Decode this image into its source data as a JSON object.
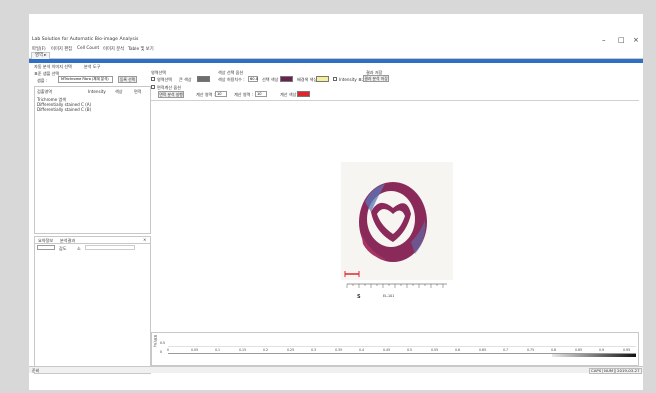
{
  "window": {
    "title": "Lab Solution for Automatic Bio-image Analysis",
    "minimize": "–",
    "maximize": "□",
    "close": "×"
  },
  "menu": [
    "파일(F)",
    "이미지 편집",
    "Cell Count",
    "이미지 분석",
    "Table 및 보기"
  ],
  "doc_tab": "영역 ▸",
  "toolbar_row": {
    "left_label": "자동 분석 이미지 선택",
    "right_label": "분석 도구"
  },
  "left_panel": {
    "sample_label": "표준 샘플 선택",
    "select_label": "샘플 :",
    "select_value": "MTrichrome Fibro (체계 분석)",
    "add_button": "등록 선택",
    "table_headers": [
      "검출영역",
      "Intensity",
      "색상",
      "면적"
    ],
    "table_rows": [
      "Trichrome 염색",
      "Differentially stained C (A)",
      "Differentially stained C (B)"
    ],
    "bottom_tabs": [
      "요약정보",
      "분석결과"
    ],
    "bottom_fields": [
      "감도",
      "소"
    ]
  },
  "right_panel": {
    "region_label": "영역선택",
    "region_check": "영역선택",
    "bg_color_label": "큰 색상",
    "color_select_label": "색상 선택 옵션",
    "tolerance_label": "색상 허용치수 :",
    "tolerance_value": "60.0",
    "select_color_label": "선택 색상 :",
    "bg_color2_label": "배경색 색상 :",
    "intensity_label": "Intensity 표기",
    "save_label": "결과 저장",
    "save_button": "결과 분석 저장",
    "second_check": "면적계산 옵션",
    "calc_button": "면적 분석 실행",
    "range_label1": "계산 영역 :",
    "range_value1": "10",
    "range_label2": "계산 영역 :",
    "range_value2": "10",
    "result_color_label": "계산 색상 :",
    "scale_label": "EL-101",
    "colors": {
      "gray": "#6e6e6e",
      "purple": "#6a2350",
      "yellow": "#f4ef9a",
      "red": "#e0262c",
      "blue_bar": "#2f6fc4"
    }
  },
  "chart_data": {
    "type": "line",
    "ylabel": "면적(%)",
    "yticks": [
      "0.5",
      "0"
    ],
    "x": [
      "0",
      "0.05",
      "0.1",
      "0.15",
      "0.2",
      "0.25",
      "0.3",
      "0.35",
      "0.4",
      "0.45",
      "0.5",
      "0.55",
      "0.6",
      "0.65",
      "0.7",
      "0.75",
      "0.8",
      "0.85",
      "0.9",
      "0.95"
    ],
    "series": []
  },
  "status": {
    "left": "준비",
    "right_values": [
      "CAPS",
      "NUM",
      "2019-03-27"
    ]
  }
}
